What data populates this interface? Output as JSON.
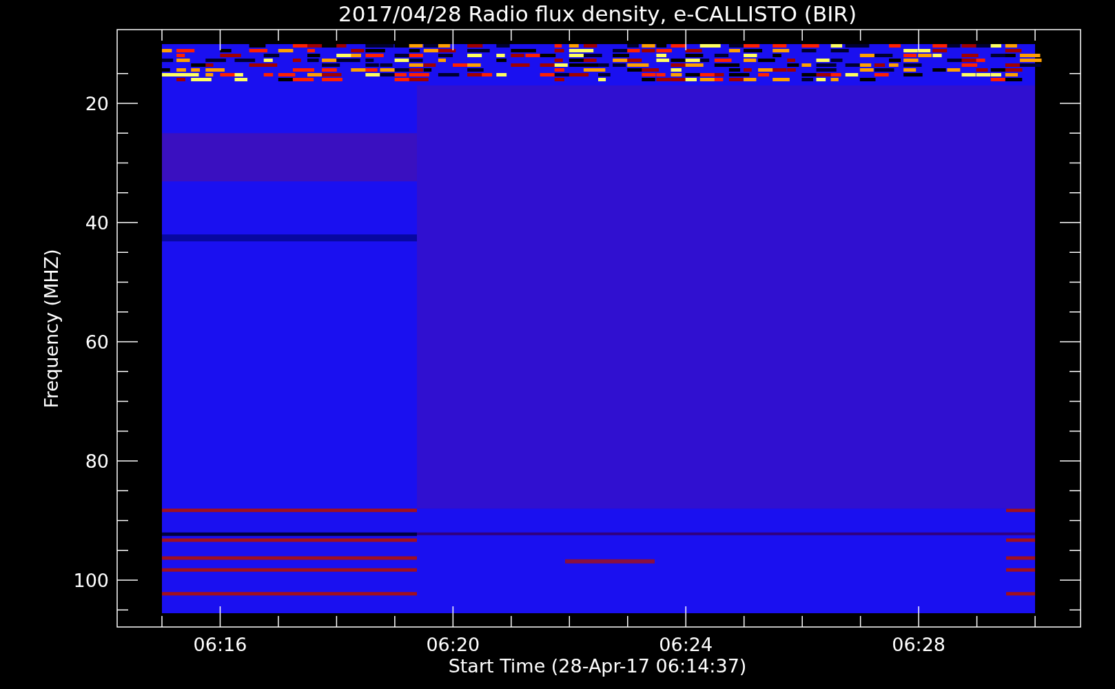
{
  "title": "2017/04/28  Radio flux density, e-CALLISTO (BIR)",
  "y_axis": {
    "label": "Frequency (MHZ)",
    "ticks": [
      "20",
      "40",
      "60",
      "80",
      "100"
    ]
  },
  "x_axis": {
    "label": "Start Time (28-Apr-17 06:14:37)",
    "ticks": [
      "06:16",
      "06:20",
      "06:24",
      "06:28"
    ]
  }
}
